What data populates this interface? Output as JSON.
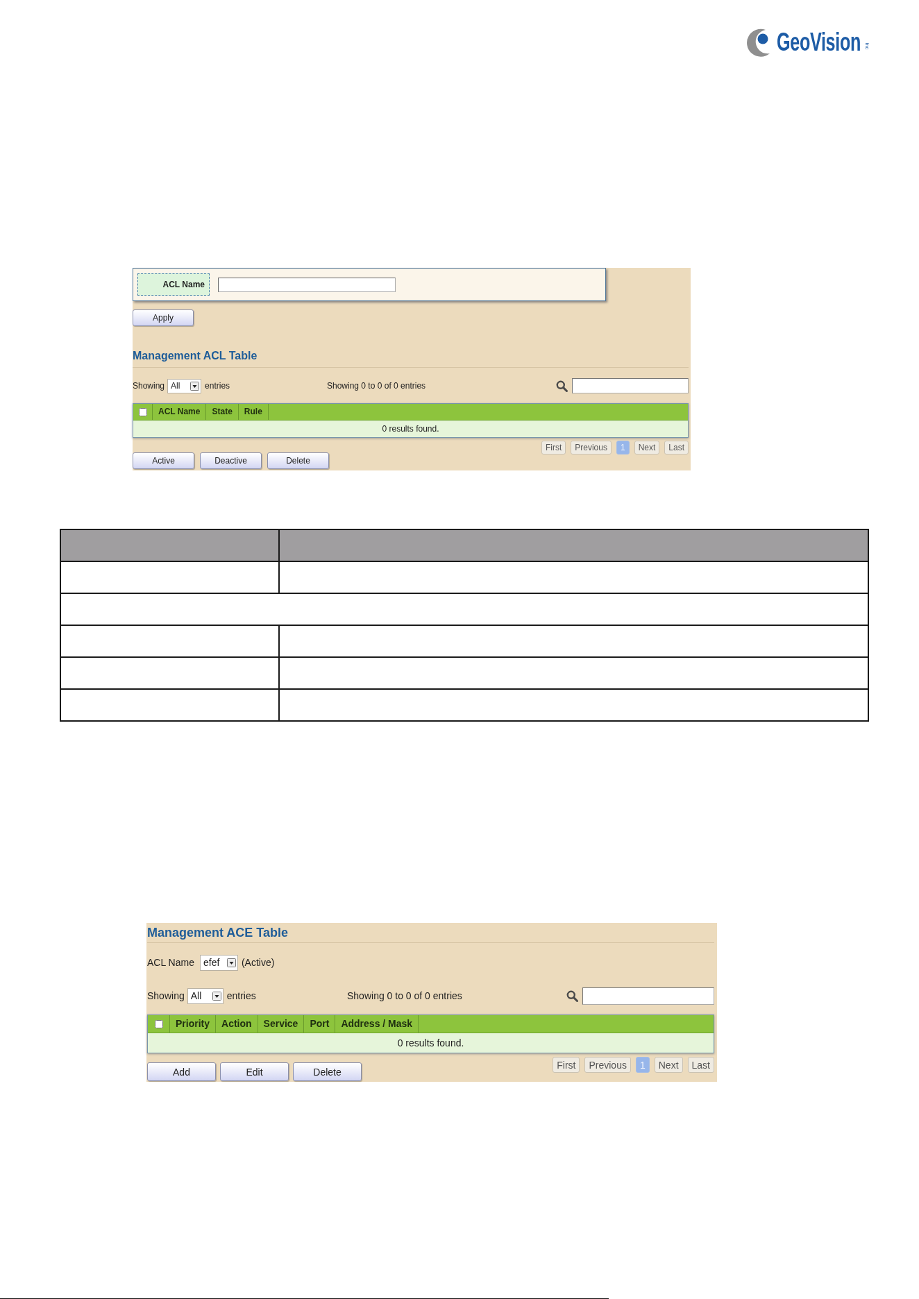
{
  "header": {
    "logo": {
      "brand": "GeoVision",
      "suffix": "inc"
    }
  },
  "acl_screenshot": {
    "form": {
      "label": "ACL Name"
    },
    "apply_button": "Apply",
    "title": "Management ACL Table",
    "length_menu": {
      "prefix": "Showing",
      "value": "All",
      "suffix": "entries"
    },
    "info": "Showing 0 to 0 of 0 entries",
    "table": {
      "select_all": {
        "checked": false
      },
      "columns": [
        "ACL Name",
        "State",
        "Rule"
      ],
      "empty_message": "0 results found."
    },
    "pagination": [
      {
        "label": "First",
        "selected": false
      },
      {
        "label": "Previous",
        "selected": false
      },
      {
        "label": "1",
        "selected": true
      },
      {
        "label": "Next",
        "selected": false
      },
      {
        "label": "Last",
        "selected": false
      }
    ],
    "buttons": [
      "Active",
      "Deactive",
      "Delete"
    ]
  },
  "description_table": {
    "rows": [
      {
        "kind": "header"
      },
      {
        "kind": "pair"
      },
      {
        "kind": "full"
      },
      {
        "kind": "pair"
      },
      {
        "kind": "pair"
      },
      {
        "kind": "pair"
      }
    ]
  },
  "ace_screenshot": {
    "title": "Management ACE Table",
    "acl_select": {
      "label": "ACL Name",
      "value": "efef",
      "status": "(Active)"
    },
    "length_menu": {
      "prefix": "Showing",
      "value": "All",
      "suffix": "entries"
    },
    "info": "Showing 0 to 0 of 0 entries",
    "table": {
      "select_all": {
        "checked": false
      },
      "columns": [
        "Priority",
        "Action",
        "Service",
        "Port",
        "Address / Mask"
      ],
      "empty_message": "0 results found."
    },
    "pagination": [
      {
        "label": "First",
        "selected": false
      },
      {
        "label": "Previous",
        "selected": false
      },
      {
        "label": "1",
        "selected": true
      },
      {
        "label": "Next",
        "selected": false
      },
      {
        "label": "Last",
        "selected": false
      }
    ],
    "buttons": [
      "Add",
      "Edit",
      "Delete"
    ]
  }
}
